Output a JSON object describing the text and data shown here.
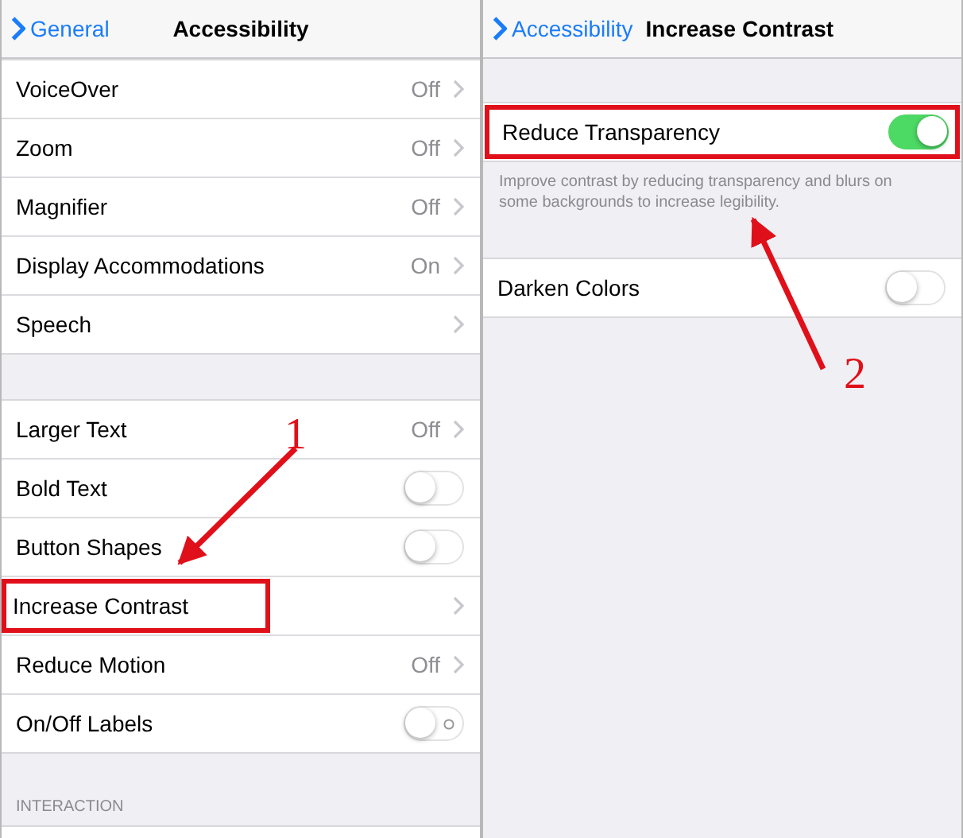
{
  "screens": [
    {
      "nav": {
        "back": "General",
        "title": "Accessibility"
      },
      "sections": [
        {
          "rows": [
            {
              "kind": "value",
              "label": "VoiceOver",
              "value": "Off"
            },
            {
              "kind": "value",
              "label": "Zoom",
              "value": "Off"
            },
            {
              "kind": "value",
              "label": "Magnifier",
              "value": "Off"
            },
            {
              "kind": "value",
              "label": "Display Accommodations",
              "value": "On"
            },
            {
              "kind": "link",
              "label": "Speech"
            }
          ]
        },
        {
          "rows": [
            {
              "kind": "value",
              "label": "Larger Text",
              "value": "Off"
            },
            {
              "kind": "toggle",
              "label": "Bold Text",
              "on": false
            },
            {
              "kind": "toggle",
              "label": "Button Shapes",
              "on": false
            },
            {
              "kind": "link",
              "label": "Increase Contrast",
              "highlighted": true
            },
            {
              "kind": "value",
              "label": "Reduce Motion",
              "value": "Off"
            },
            {
              "kind": "toggle",
              "label": "On/Off Labels",
              "on": false,
              "show_labels": true
            }
          ]
        },
        {
          "header": "INTERACTION"
        }
      ],
      "annotation": {
        "label": "1"
      }
    },
    {
      "nav": {
        "back": "Accessibility",
        "title": "Increase Contrast"
      },
      "sections": [
        {
          "rows": [
            {
              "kind": "toggle",
              "label": "Reduce Transparency",
              "on": true,
              "highlighted": true
            }
          ],
          "footer": "Improve contrast by reducing transparency and blurs on some backgrounds to increase legibility."
        },
        {
          "rows": [
            {
              "kind": "toggle",
              "label": "Darken Colors",
              "on": false
            }
          ]
        }
      ],
      "annotation": {
        "label": "2"
      }
    }
  ]
}
